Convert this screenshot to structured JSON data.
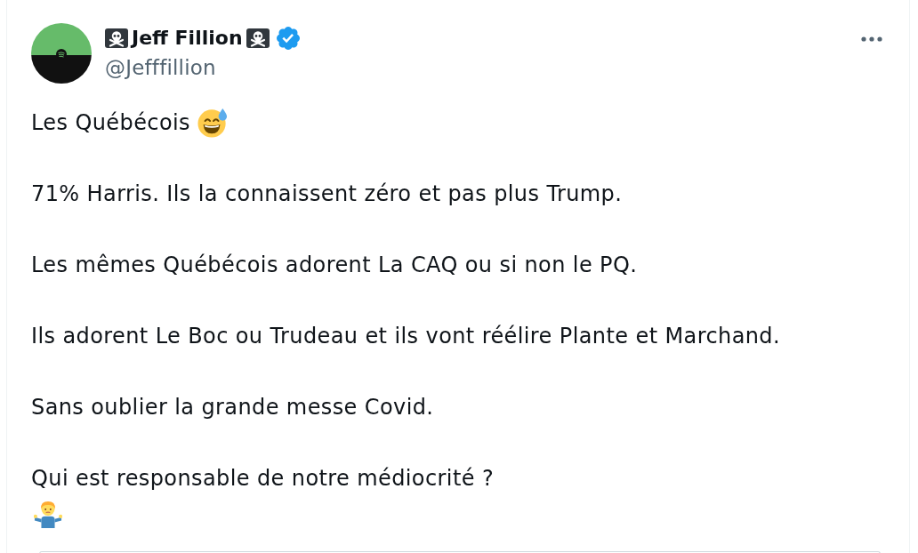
{
  "post": {
    "author": {
      "display_name": "Jeff Fillion",
      "handle": "@Jefffillion",
      "verified": true
    },
    "paragraphs": [
      "Les Québécois",
      "71% Harris. Ils la connaissent zéro et pas plus Trump.",
      "Les mêmes Québécois adorent La CAQ ou si non le PQ.",
      "Ils adorent Le Boc ou Trudeau et ils vont réélire Plante et Marchand.",
      "Sans oublier la grande messe Covid.",
      "Qui est responsable de notre médiocrité ?"
    ]
  }
}
